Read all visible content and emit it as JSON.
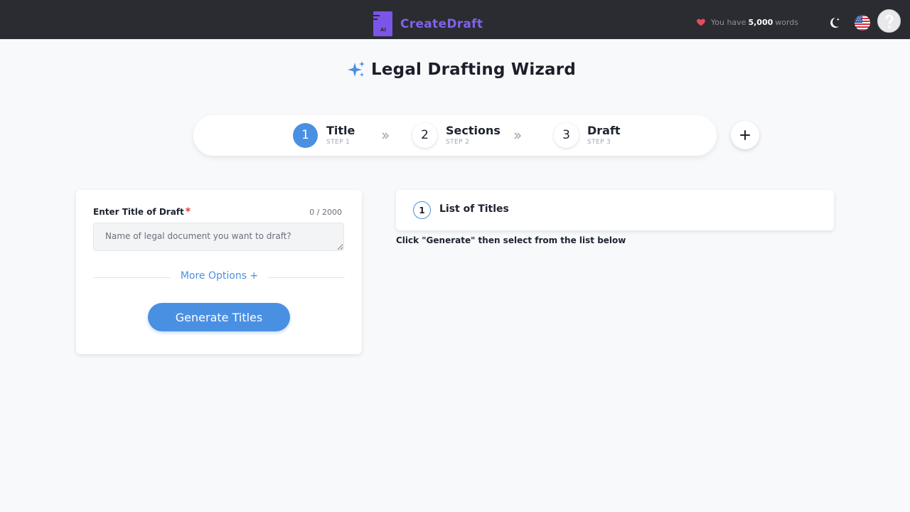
{
  "header": {
    "brand_name": "CreateDraft",
    "logo_text": "AI",
    "words_prefix": "You have",
    "words_count": "5,000",
    "words_suffix": "words",
    "icons": [
      "heart-icon",
      "moon-icon",
      "us-flag-icon",
      "help-avatar-icon"
    ]
  },
  "page": {
    "title": "Legal Drafting Wizard",
    "title_icon": "sparkle-icon"
  },
  "stepper": {
    "steps": [
      {
        "num": "1",
        "label": "Title",
        "sub": "STEP 1",
        "active": true
      },
      {
        "num": "2",
        "label": "Sections",
        "sub": "STEP 2",
        "active": false
      },
      {
        "num": "3",
        "label": "Draft",
        "sub": "STEP 3",
        "active": false
      }
    ],
    "add_icon": "plus-icon"
  },
  "form": {
    "label": "Enter Title of Draft",
    "required_mark": "*",
    "counter": "0 / 2000",
    "input_value": "",
    "input_placeholder": "Name of legal document you want to draft?",
    "more_options": "More Options +",
    "generate_label": "Generate Titles"
  },
  "titles_panel": {
    "num": "1",
    "title": "List of Titles",
    "hint": "Click \"Generate\" then select from the list below"
  },
  "colors": {
    "topbar": "#2a2c31",
    "brand": "#7b55e8",
    "accent": "#4a90e2",
    "required": "#e53935",
    "heart": "#e84a5f",
    "background": "#f8f9fb"
  }
}
